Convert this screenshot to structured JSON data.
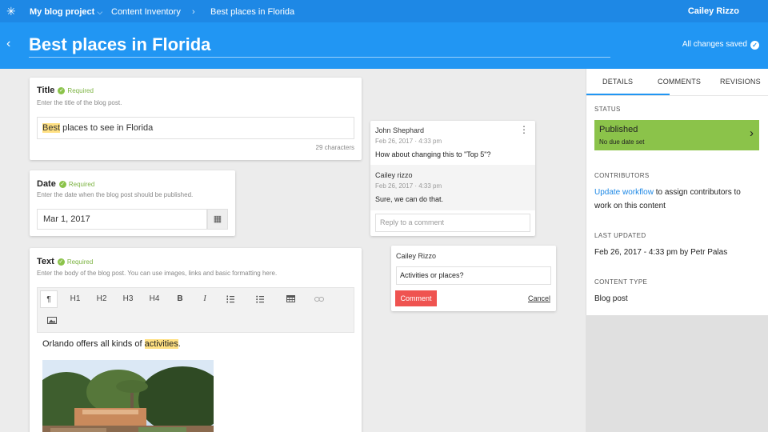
{
  "topbar": {
    "logo_icon": "kontent-logo-icon",
    "project": "My blog project",
    "project_caret": "⌵",
    "inventory": "Content Inventory",
    "separator": "›",
    "current": "Best places in Florida",
    "user": "Cailey Rizzo"
  },
  "header": {
    "back_glyph": "‹",
    "title": "Best places in Florida",
    "saved": "All changes saved"
  },
  "fields": {
    "title": {
      "label": "Title",
      "required": "Required",
      "hint": "Enter the title of the blog post.",
      "value_highlight": "Best",
      "value_rest": " places to see in Florida",
      "counter": "29 characters"
    },
    "date": {
      "label": "Date",
      "required": "Required",
      "hint": "Enter the date when the blog post should be published.",
      "value": "Mar 1, 2017"
    },
    "text": {
      "label": "Text",
      "required": "Required",
      "hint": "Enter the body of the blog post. You can use images, links and basic formatting here.",
      "toolbar": [
        "¶",
        "H1",
        "H2",
        "H3",
        "H4",
        "B",
        "I"
      ],
      "body_before": "Orlando offers all kinds of ",
      "body_highlight": "activities",
      "body_after": "."
    }
  },
  "comment_thread": {
    "items": [
      {
        "author": "John Shephard",
        "date": "Feb 26, 2017 · 4:33 pm",
        "text": "How about changing this to \"Top 5\"?"
      },
      {
        "author": "Cailey rizzo",
        "date": "Feb 26, 2017 · 4:33 pm",
        "text": "Sure, we can do that."
      }
    ],
    "reply_placeholder": "Reply to a comment"
  },
  "new_comment": {
    "author": "Cailey Rizzo",
    "value": "Activities or places?",
    "submit": "Comment",
    "cancel": "Cancel"
  },
  "panel": {
    "tabs": [
      "DETAILS",
      "COMMENTS",
      "REVISIONS"
    ],
    "status_label": "STATUS",
    "status_value": "Published",
    "status_sub": "No due date set",
    "contributors_label": "CONTRIBUTORS",
    "contributors_link": "Update workflow",
    "contributors_rest": " to assign contributors to",
    "contributors_line2": "work on this content",
    "updated_label": "LAST UPDATED",
    "updated_value": "Feb 26, 2017 - 4:33 pm by Petr Palas",
    "type_label": "CONTENT TYPE",
    "type_value": "Blog post"
  },
  "colors": {
    "topbar": "#1e88e5",
    "header": "#2196f3",
    "required": "#7cb342",
    "status": "#8bc34a",
    "comment_button": "#ef5350",
    "highlight": "#ffe082"
  }
}
